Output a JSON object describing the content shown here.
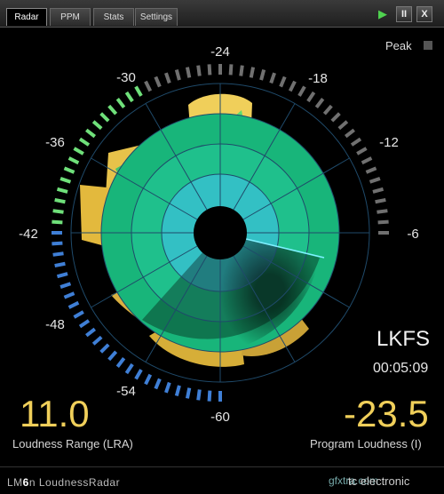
{
  "tabs": [
    {
      "label": "Radar",
      "active": true
    },
    {
      "label": "PPM",
      "active": false
    },
    {
      "label": "Stats",
      "active": false
    },
    {
      "label": "Settings",
      "active": false
    }
  ],
  "controls": {
    "play": "▶",
    "pause": "II",
    "close": "X"
  },
  "peak": {
    "label": "Peak"
  },
  "scale_labels": [
    "-6",
    "-12",
    "-18",
    "-24",
    "-30",
    "-36",
    "-42",
    "-48",
    "-54",
    "-60"
  ],
  "readout": {
    "unit": "LKFS",
    "time": "00:05:09",
    "lra_value": "11.0",
    "lra_label": "Loudness Range (LRA)",
    "program_value": "-23.5",
    "program_label": "Program Loudness (I)"
  },
  "footer": {
    "product_prefix": "LM",
    "product_suffix": "6",
    "product_model": "n LoudnessRadar",
    "maker": "tc electronic",
    "watermark": "gfxtra.com"
  },
  "colors": {
    "background": "#000000",
    "accent_yellow": "#f0cf5a",
    "radar_green": "#1fc27a",
    "radar_cyan": "#33c0c4",
    "bright_green": "#6fe07a"
  }
}
